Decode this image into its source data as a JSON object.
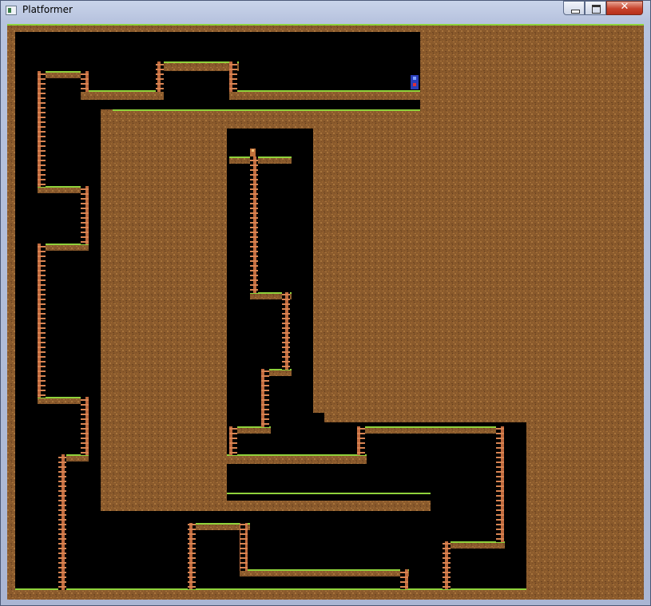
{
  "window": {
    "title": "Platformer",
    "controls": {
      "minimize": "minimize",
      "maximize": "maximize",
      "close": "✕"
    }
  },
  "game": {
    "colors": {
      "dirt": "#8a5a2c",
      "dirt_dark": "#6d4420",
      "dirt_light": "#a8743c",
      "grass": "#8fd23b",
      "void": "#000000",
      "ladder": "#b5623a",
      "player": "#2a3db7"
    },
    "entities": [
      {
        "name": "player",
        "icon": "player-sprite"
      },
      {
        "name": "coin",
        "icon": "small-item-sprite"
      }
    ]
  }
}
